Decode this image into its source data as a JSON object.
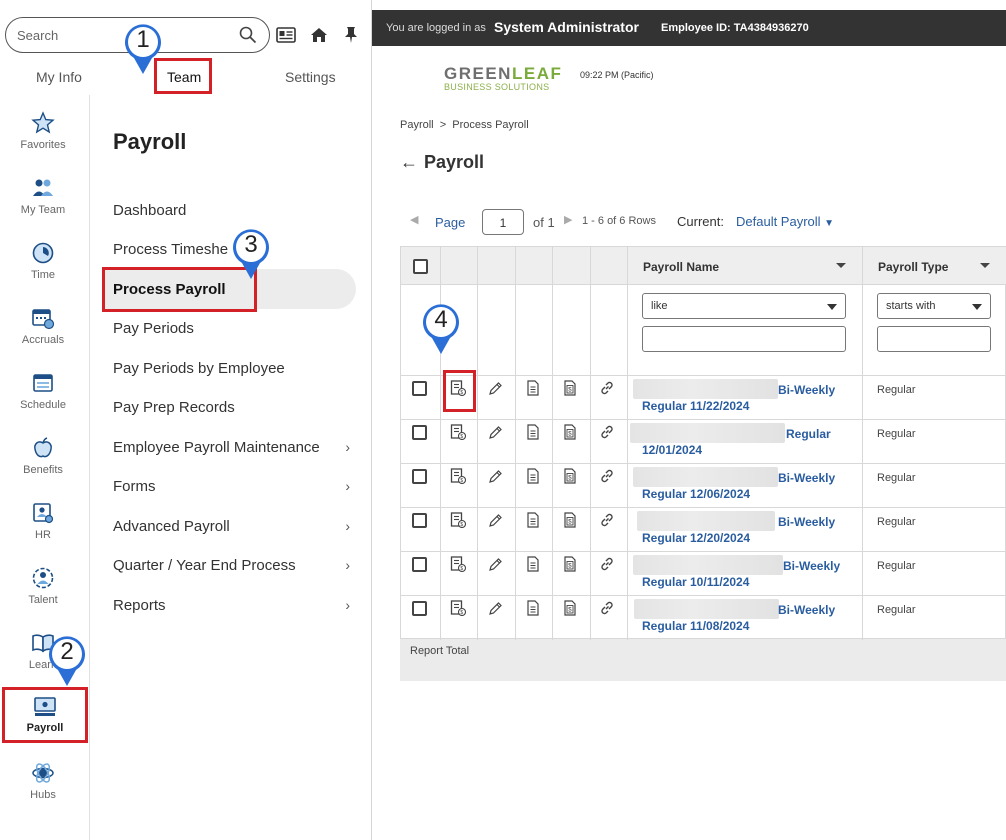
{
  "search": {
    "placeholder": "Search"
  },
  "top_icons": [
    "id-card-icon",
    "home-icon",
    "pin-icon"
  ],
  "tabs": [
    {
      "label": "My Info"
    },
    {
      "label": "Team"
    },
    {
      "label": "Settings"
    }
  ],
  "rail": [
    {
      "label": "Favorites",
      "icon": "star-icon"
    },
    {
      "label": "My Team",
      "icon": "team-icon"
    },
    {
      "label": "Time",
      "icon": "clock-icon"
    },
    {
      "label": "Accruals",
      "icon": "calendar-clock-icon"
    },
    {
      "label": "Schedule",
      "icon": "calendar-icon"
    },
    {
      "label": "Benefits",
      "icon": "apple-icon"
    },
    {
      "label": "HR",
      "icon": "hr-icon"
    },
    {
      "label": "Talent",
      "icon": "talent-icon"
    },
    {
      "label": "Learn",
      "icon": "book-icon"
    },
    {
      "label": "Payroll",
      "icon": "monitor-icon"
    },
    {
      "label": "Hubs",
      "icon": "hubs-icon"
    }
  ],
  "menu": {
    "title": "Payroll",
    "items": [
      {
        "label": "Dashboard",
        "chevron": false
      },
      {
        "label": "Process Timeshe",
        "chevron": false
      },
      {
        "label": "Process Payroll",
        "chevron": false
      },
      {
        "label": "Pay Periods",
        "chevron": false
      },
      {
        "label": "Pay Periods by Employee",
        "chevron": false
      },
      {
        "label": "Pay Prep Records",
        "chevron": false
      },
      {
        "label": "Employee Payroll Maintenance",
        "chevron": true
      },
      {
        "label": "Forms",
        "chevron": true
      },
      {
        "label": "Advanced Payroll",
        "chevron": true
      },
      {
        "label": "Quarter / Year End Process",
        "chevron": true
      },
      {
        "label": "Reports",
        "chevron": true
      }
    ]
  },
  "callouts": [
    "1",
    "2",
    "3",
    "4"
  ],
  "topbar": {
    "login_prefix": "You are logged in as",
    "user": "System Administrator",
    "employee_id": "Employee ID: TA4384936270"
  },
  "logo": {
    "line1_a": "GREEN",
    "line1_b": "LEAF",
    "line2": "BUSINESS SOLUTIONS"
  },
  "clock": "09:22 PM (Pacific)",
  "breadcrumb": "Payroll  >  Process Payroll",
  "page_title": "Payroll",
  "pager": {
    "page_label": "Page",
    "page_value": "1",
    "of": "of 1",
    "rows": "1 - 6 of 6 Rows",
    "current_label": "Current:",
    "current_value": "Default Payroll"
  },
  "table": {
    "columns": [
      "Payroll Name",
      "Payroll Type"
    ],
    "filters": {
      "name_op": "like",
      "type_op": "starts with"
    },
    "rows": [
      {
        "name_tail": "Bi-Weekly",
        "name_line2": "Regular 11/22/2024",
        "type": "Regular"
      },
      {
        "name_tail": "Regular",
        "name_line2": "12/01/2024",
        "type": "Regular"
      },
      {
        "name_tail": "Bi-Weekly",
        "name_line2": "Regular 12/06/2024",
        "type": "Regular"
      },
      {
        "name_tail": "Bi-Weekly",
        "name_line2": "Regular 12/20/2024",
        "type": "Regular"
      },
      {
        "name_tail": "Bi-Weekly",
        "name_line2": "Regular 10/11/2024",
        "type": "Regular"
      },
      {
        "name_tail": "Bi-Weekly",
        "name_line2": "Regular 11/08/2024",
        "type": "Regular"
      }
    ],
    "footer": "Report Total"
  },
  "colors": {
    "accent": "#2a5d9f",
    "highlight": "#d42027",
    "callout": "#2b6fd6",
    "topbar": "#333333"
  }
}
